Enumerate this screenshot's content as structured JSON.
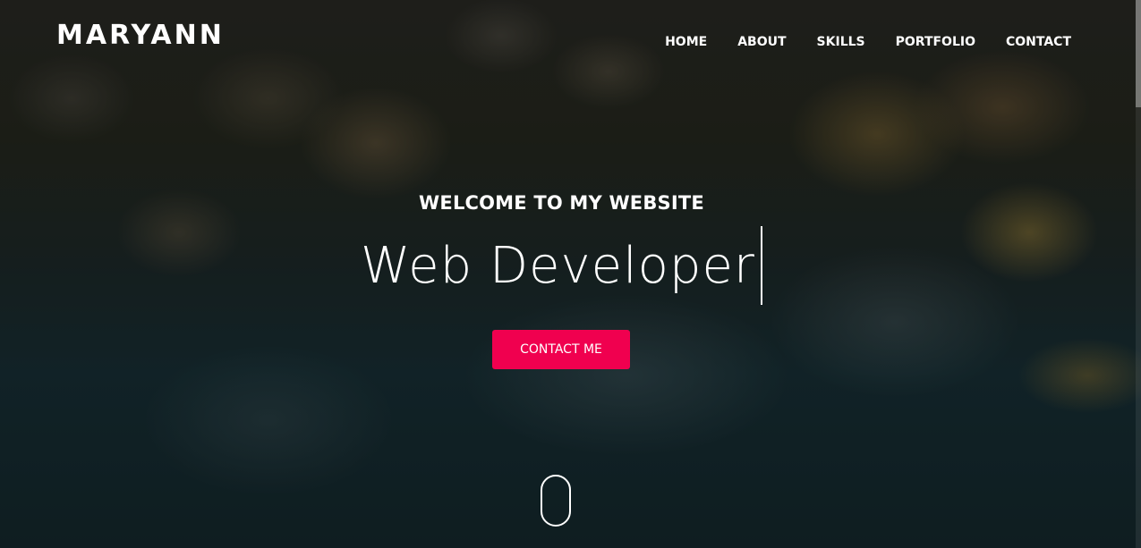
{
  "brand": {
    "logo_text": "MARYANN"
  },
  "nav": {
    "items": [
      {
        "label": "HOME"
      },
      {
        "label": "ABOUT"
      },
      {
        "label": "SKILLS"
      },
      {
        "label": "PORTFOLIO"
      },
      {
        "label": "CONTACT"
      }
    ]
  },
  "hero": {
    "subtitle": "WELCOME TO MY WEBSITE",
    "typed_text": "Web Developer",
    "cta_label": "CONTACT ME"
  },
  "colors": {
    "accent": "#f0004f",
    "text": "#ffffff"
  },
  "icons": {
    "scroll": "mouse-scroll-icon"
  }
}
